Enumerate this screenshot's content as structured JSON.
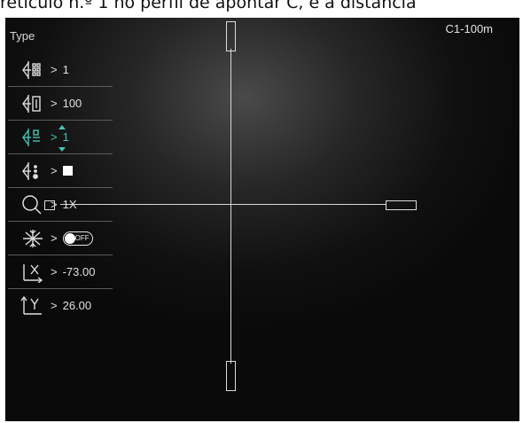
{
  "caption": "retículo n.º 1 no perfil de apontar C, e a distância",
  "header": {
    "type_label": "Type",
    "profile_label": "C1-100m"
  },
  "menu": {
    "items": [
      {
        "icon": "reticle-style-icon",
        "value": "1"
      },
      {
        "icon": "reticle-distance-icon",
        "value": "100"
      },
      {
        "icon": "reticle-number-icon",
        "value": "1",
        "active": true
      },
      {
        "icon": "reticle-color-icon",
        "value_shape": "white-square"
      },
      {
        "icon": "zoom-icon",
        "value": "1X"
      },
      {
        "icon": "freeze-icon",
        "toggle_label": "OFF",
        "toggle_state": "off"
      },
      {
        "icon": "x-coordinate-icon",
        "value": "-73.00"
      },
      {
        "icon": "y-coordinate-icon",
        "value": "26.00"
      }
    ],
    "arrow": ">"
  },
  "colors": {
    "accent": "#46c3b2",
    "background": "#0a0a0a",
    "text": "#e0e0e0"
  }
}
